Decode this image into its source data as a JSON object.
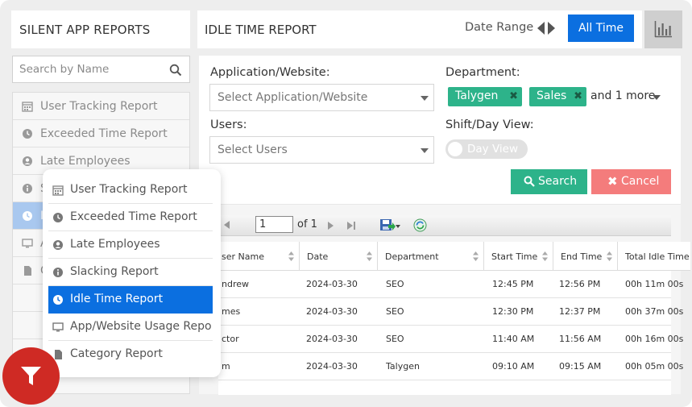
{
  "sidebar": {
    "title": "SILENT APP REPORTS",
    "search_placeholder": "Search by Name",
    "items": [
      {
        "label": "User Tracking Report",
        "icon": "calendar-icon"
      },
      {
        "label": "Exceeded Time Report",
        "icon": "clock-icon"
      },
      {
        "label": "Late Employees",
        "icon": "user-circle-icon"
      },
      {
        "label": "S",
        "icon": "info-icon"
      },
      {
        "label": "I",
        "icon": "clock-icon"
      },
      {
        "label": "A",
        "icon": "monitor-icon"
      },
      {
        "label": "C",
        "icon": "file-icon"
      }
    ]
  },
  "header": {
    "title": "IDLE TIME REPORT",
    "date_range_label": "Date Range",
    "all_time_label": "All Time",
    "chart_icon": "bar-chart-icon"
  },
  "filters": {
    "application_label": "Application/Website:",
    "application_placeholder": "Select Application/Website",
    "department_label": "Department:",
    "department_tags": [
      "Talygen",
      "Sales"
    ],
    "department_more": "and 1 more",
    "users_label": "Users:",
    "users_placeholder": "Select Users",
    "shift_label": "Shift/Day View:",
    "toggle_label": "Day View",
    "search_button": "Search",
    "cancel_button": "Cancel"
  },
  "report": {
    "page_value": "1",
    "page_of": "of 1",
    "columns": [
      "ser Name",
      "Date",
      "Department",
      "Start Time",
      "End Time",
      "Total Idle Time"
    ],
    "rows": [
      [
        "ndrew",
        "2024-03-30",
        "SEO",
        "12:45 PM",
        "12:56 PM",
        "00h 11m 00s"
      ],
      [
        "mes",
        "2024-03-30",
        "SEO",
        "12:30 PM",
        "12:37 PM",
        "00h 37m 00s"
      ],
      [
        "ctor",
        "2024-03-30",
        "SEO",
        "11:40 AM",
        "11:56 AM",
        "00h 16m 00s"
      ],
      [
        "m",
        "2024-03-30",
        "Talygen",
        "09:10 AM",
        "09:15 AM",
        "00h 05m 00s"
      ]
    ]
  },
  "popup": {
    "items": [
      {
        "label": "User Tracking Report",
        "icon": "calendar-icon"
      },
      {
        "label": "Exceeded Time Report",
        "icon": "clock-icon"
      },
      {
        "label": "Late Employees",
        "icon": "user-circle-icon"
      },
      {
        "label": "Slacking Report",
        "icon": "info-icon"
      },
      {
        "label": "Idle Time Report",
        "icon": "clock-icon",
        "selected": true
      },
      {
        "label": "App/Website Usage Repo",
        "icon": "monitor-icon"
      },
      {
        "label": "Category Report",
        "icon": "file-icon"
      }
    ]
  },
  "colors": {
    "accent_blue": "#0b6fe0",
    "green": "#2db38a",
    "cancel_red": "#f47c7c",
    "fab_red": "#cf2a24"
  },
  "fab_icon": "filter-icon"
}
